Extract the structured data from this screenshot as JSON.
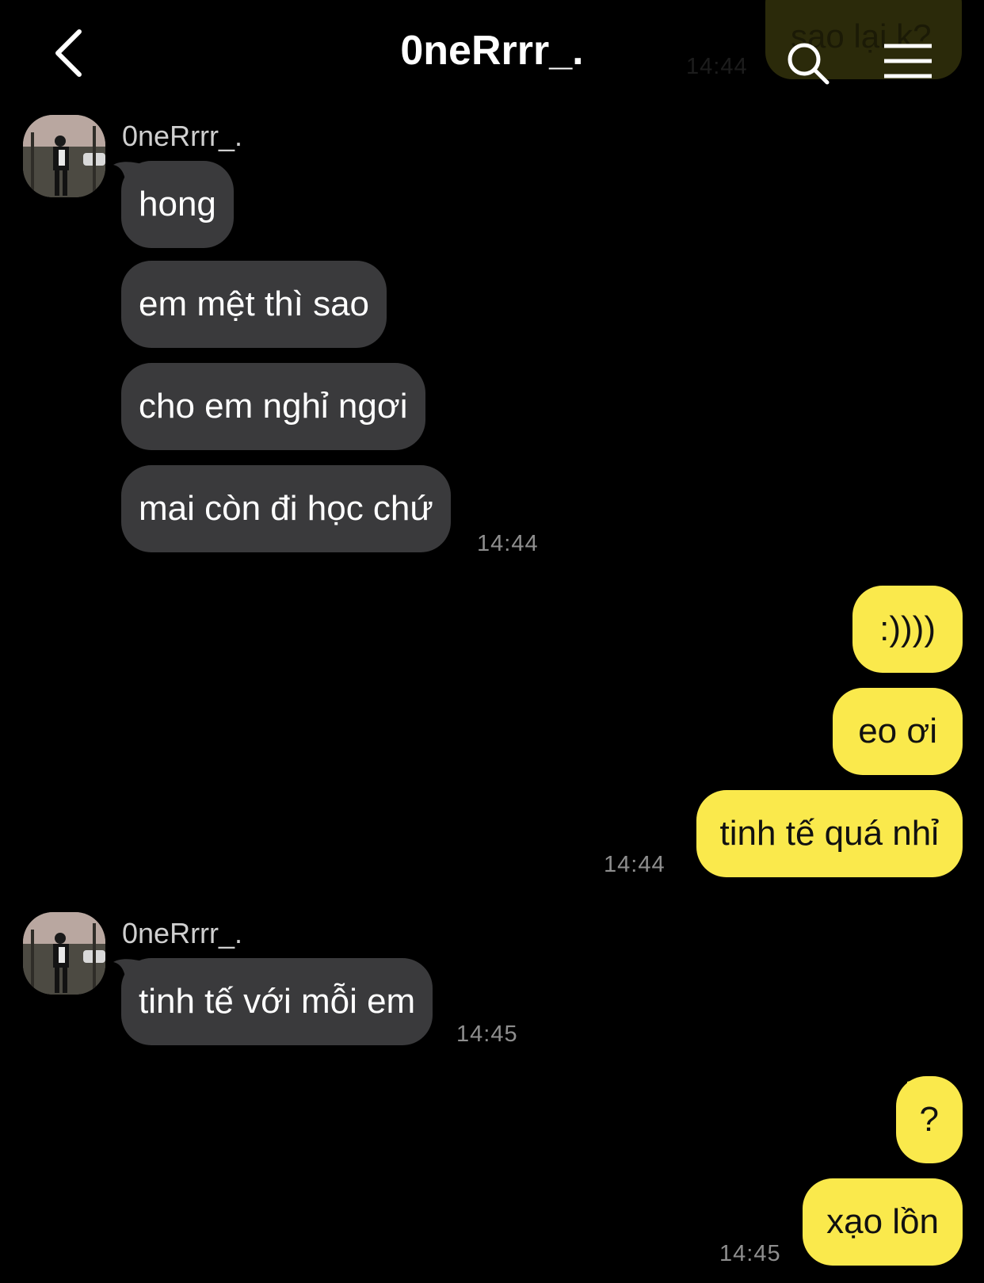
{
  "header": {
    "title": "0neRrrr_.",
    "back_icon": "chevron-left-icon",
    "search_icon": "search-icon",
    "menu_icon": "hamburger-menu-icon"
  },
  "ghost": {
    "text": "sao lại k?",
    "time": "14:44"
  },
  "colors": {
    "background": "#000000",
    "incoming_bubble": "#3a3a3c",
    "outgoing_bubble": "#fae94c",
    "timestamp": "#8e8e8e"
  },
  "messages": {
    "group1": {
      "sender": "0neRrrr_.",
      "items": [
        "hong",
        "em mệt thì sao",
        "cho em nghỉ ngơi",
        "mai còn đi học chứ"
      ],
      "time": "14:44"
    },
    "group2": {
      "items": [
        ":))))",
        "eo ơi",
        "tinh tế quá nhỉ"
      ],
      "time": "14:44"
    },
    "group3": {
      "sender": "0neRrrr_.",
      "items": [
        "tinh tế với mỗi em"
      ],
      "time": "14:45"
    },
    "group4": {
      "items": [
        "?",
        "xạo lồn"
      ],
      "time": "14:45"
    }
  }
}
